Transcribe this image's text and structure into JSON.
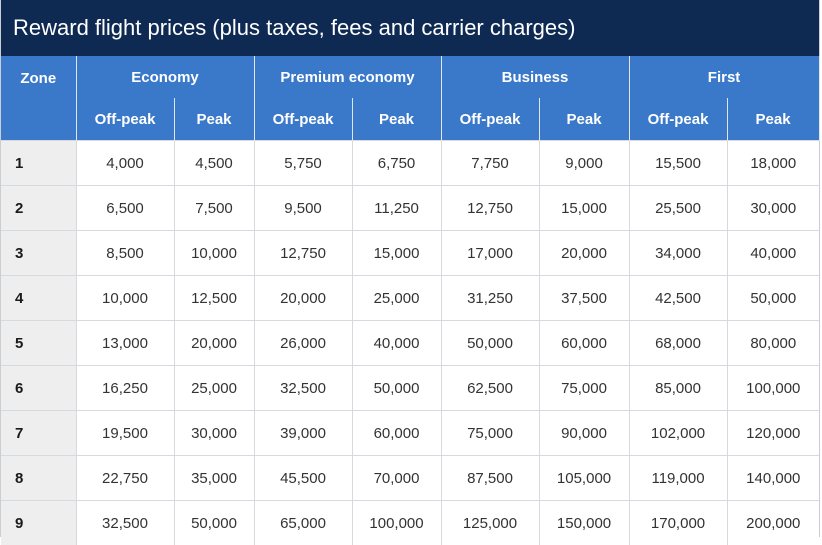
{
  "title": "Reward flight prices (plus taxes, fees and carrier charges)",
  "zone_header": "Zone",
  "cabins": [
    {
      "name": "Economy"
    },
    {
      "name": "Premium economy"
    },
    {
      "name": "Business"
    },
    {
      "name": "First"
    }
  ],
  "sub_headers": [
    "Off-peak",
    "Peak"
  ],
  "rows": [
    {
      "zone": "1",
      "values": [
        "4,000",
        "4,500",
        "5,750",
        "6,750",
        "7,750",
        "9,000",
        "15,500",
        "18,000"
      ]
    },
    {
      "zone": "2",
      "values": [
        "6,500",
        "7,500",
        "9,500",
        "11,250",
        "12,750",
        "15,000",
        "25,500",
        "30,000"
      ]
    },
    {
      "zone": "3",
      "values": [
        "8,500",
        "10,000",
        "12,750",
        "15,000",
        "17,000",
        "20,000",
        "34,000",
        "40,000"
      ]
    },
    {
      "zone": "4",
      "values": [
        "10,000",
        "12,500",
        "20,000",
        "25,000",
        "31,250",
        "37,500",
        "42,500",
        "50,000"
      ]
    },
    {
      "zone": "5",
      "values": [
        "13,000",
        "20,000",
        "26,000",
        "40,000",
        "50,000",
        "60,000",
        "68,000",
        "80,000"
      ]
    },
    {
      "zone": "6",
      "values": [
        "16,250",
        "25,000",
        "32,500",
        "50,000",
        "62,500",
        "75,000",
        "85,000",
        "100,000"
      ]
    },
    {
      "zone": "7",
      "values": [
        "19,500",
        "30,000",
        "39,000",
        "60,000",
        "75,000",
        "90,000",
        "102,000",
        "120,000"
      ]
    },
    {
      "zone": "8",
      "values": [
        "22,750",
        "35,000",
        "45,500",
        "70,000",
        "87,500",
        "105,000",
        "119,000",
        "140,000"
      ]
    },
    {
      "zone": "9",
      "values": [
        "32,500",
        "50,000",
        "65,000",
        "100,000",
        "125,000",
        "150,000",
        "170,000",
        "200,000"
      ]
    }
  ],
  "colors": {
    "title_background": "#0f2a52",
    "header_background": "#3a78c9",
    "zone_column_background": "#eeeeee"
  }
}
